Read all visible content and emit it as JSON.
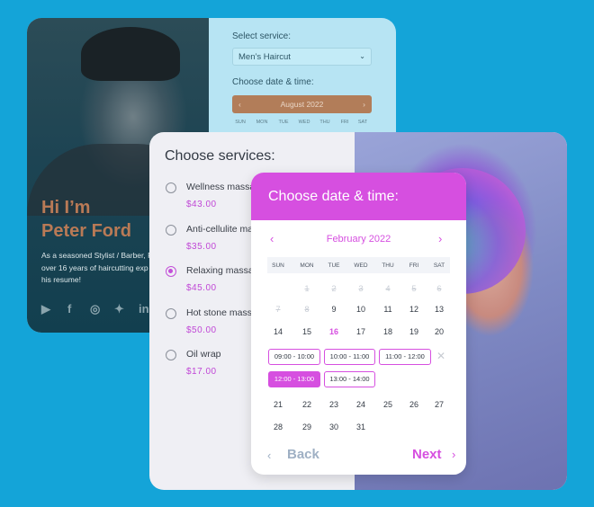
{
  "profile": {
    "greeting": "Hi I’m",
    "name": "Peter Ford",
    "bio": [
      "As a seasoned Stylist / Barber, P",
      "over 16 years of haircutting exp",
      "his resume!"
    ],
    "social_icons": [
      "youtube-icon",
      "facebook-icon",
      "instagram-icon",
      "twitter-icon",
      "linkedin-icon"
    ]
  },
  "booking": {
    "service_label": "Select service:",
    "service_value": "Men’s Haircut",
    "date_label": "Choose date & time:",
    "month": "August 2022",
    "days": [
      "SUN",
      "MON",
      "TUE",
      "WED",
      "THU",
      "FRI",
      "SAT"
    ],
    "accent": "#b27d59"
  },
  "services": {
    "title": "Choose services:",
    "items": [
      {
        "name": "Wellness massa",
        "price": "$43.00",
        "selected": false
      },
      {
        "name": "Anti-cellulite ma",
        "price": "$35.00",
        "selected": false
      },
      {
        "name": "Relaxing massa",
        "price": "$45.00",
        "selected": true
      },
      {
        "name": "Hot stone mass",
        "price": "$50.00",
        "selected": false
      },
      {
        "name": "Oil wrap",
        "price": "$17.00",
        "selected": false
      }
    ]
  },
  "calendar": {
    "title": "Choose date & time:",
    "month": "February 2022",
    "days": [
      "SUN",
      "MON",
      "TUE",
      "WED",
      "THU",
      "FRI",
      "SAT"
    ],
    "week1": [
      "1",
      "2",
      "3",
      "4",
      "5",
      "6"
    ],
    "week2": [
      "7",
      "8",
      "9",
      "10",
      "11",
      "12",
      "13"
    ],
    "week3": [
      "14",
      "15",
      "16",
      "17",
      "18",
      "19",
      "20"
    ],
    "week4": [
      "21",
      "22",
      "23",
      "24",
      "25",
      "26",
      "27"
    ],
    "week5": [
      "28",
      "29",
      "30",
      "31"
    ],
    "selected_day": "16",
    "slots": [
      "09:00 - 10:00",
      "10:00 - 11:00",
      "11:00 - 12:00",
      "12:00 - 13:00",
      "13:00 - 14:00"
    ],
    "selected_slot": "12:00 - 13:00",
    "back": "Back",
    "next": "Next",
    "accent": "#d64fe0"
  }
}
